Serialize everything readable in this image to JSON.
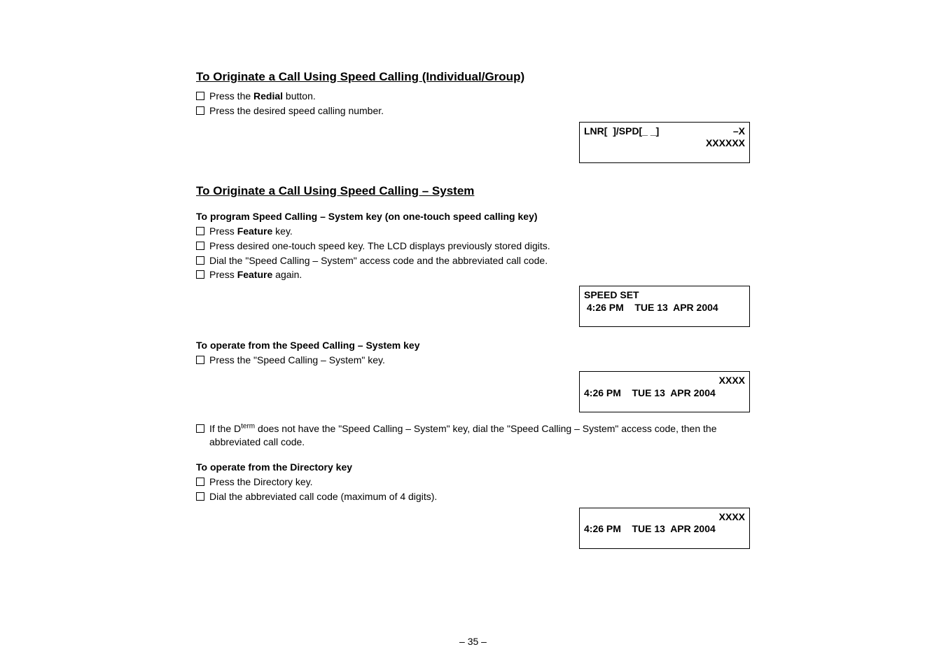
{
  "section1": {
    "heading": "To Originate a Call Using Speed Calling (Individual/Group)",
    "items": [
      {
        "pre": "Press the ",
        "bold": "Redial",
        "post": " button."
      },
      {
        "pre": "Press the desired speed calling number.",
        "bold": "",
        "post": ""
      }
    ],
    "lcd": {
      "row1_left": "LNR[  ]/SPD[_ _]",
      "row1_right": "–X",
      "row2_right": "XXXXXX"
    }
  },
  "section2": {
    "heading": "To Originate a Call Using Speed Calling – System",
    "sub1": {
      "heading": "To program Speed Calling – System key (on one-touch speed calling key)",
      "items": [
        {
          "pre": "Press ",
          "bold": "Feature",
          "post": " key."
        },
        {
          "pre": "Press desired one-touch speed key. The LCD displays previously stored digits.",
          "bold": "",
          "post": ""
        },
        {
          "pre": "Dial the \"Speed Calling – System\" access code and the abbreviated call code.",
          "bold": "",
          "post": ""
        },
        {
          "pre": "Press ",
          "bold": "Feature",
          "post": " again."
        }
      ],
      "lcd": {
        "row1_left": "SPEED SET",
        "row2_left": " 4:26 PM    TUE 13  APR 2004"
      }
    },
    "sub2": {
      "heading": "To operate from the Speed Calling – System key",
      "items": [
        {
          "pre": "Press the \"Speed Calling – System\" key.",
          "bold": "",
          "post": ""
        }
      ],
      "lcd": {
        "row1_right": "XXXX",
        "row2_left": "4:26 PM    TUE 13  APR 2004"
      },
      "note_pre": "If the D",
      "note_sup": "term",
      "note_post": " does not have the \"Speed Calling – System\" key, dial the \"Speed Calling – System\" access code, then the abbreviated call code."
    },
    "sub3": {
      "heading": "To operate from the Directory key",
      "items": [
        {
          "pre": "Press the Directory key.",
          "bold": "",
          "post": ""
        },
        {
          "pre": "Dial the abbreviated call code (maximum of 4 digits).",
          "bold": "",
          "post": ""
        }
      ],
      "lcd": {
        "row1_right": "XXXX",
        "row2_left": "4:26 PM    TUE 13  APR 2004"
      }
    }
  },
  "pagenum": "– 35 –"
}
